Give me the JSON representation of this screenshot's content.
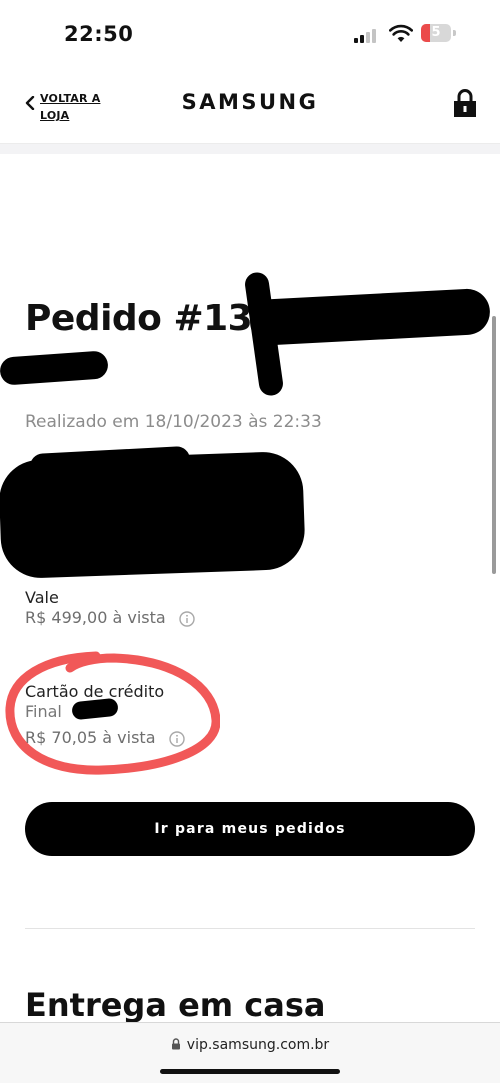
{
  "status_bar": {
    "time": "22:50",
    "battery_level": "5",
    "battery_color": "#eb4b4b"
  },
  "header": {
    "back_label": "VOLTAR A LOJA",
    "logo": "SAMSUNG"
  },
  "order": {
    "title": "Pedido #136",
    "date": "Realizado em 18/10/2023 às 22:33"
  },
  "payments": [
    {
      "label": "Vale",
      "amount": "R$ 499,00 à vista"
    },
    {
      "label": "Cartão de crédito",
      "detail": "Final",
      "amount": "R$ 70,05 à vista"
    }
  ],
  "cta_label": "Ir para meus pedidos",
  "section_title": "Entrega em casa",
  "url_bar": {
    "url": "vip.samsung.com.br"
  },
  "colors": {
    "accent": "#000000",
    "highlight": "#f04a4a",
    "muted_text": "#8c8c8c"
  }
}
